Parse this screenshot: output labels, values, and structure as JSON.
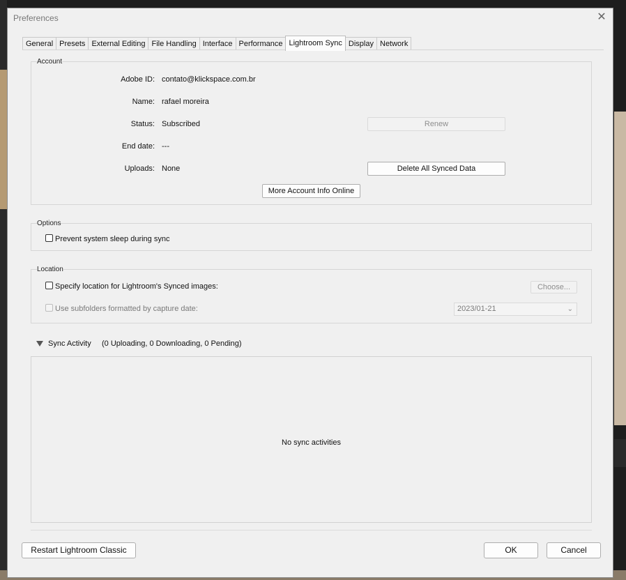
{
  "window": {
    "title": "Preferences"
  },
  "tabs": [
    {
      "label": "General"
    },
    {
      "label": "Presets"
    },
    {
      "label": "External Editing"
    },
    {
      "label": "File Handling"
    },
    {
      "label": "Interface"
    },
    {
      "label": "Performance"
    },
    {
      "label": "Lightroom Sync"
    },
    {
      "label": "Display"
    },
    {
      "label": "Network"
    }
  ],
  "account": {
    "group_title": "Account",
    "adobe_id_label": "Adobe ID:",
    "adobe_id_value": "contato@klickspace.com.br",
    "name_label": "Name:",
    "name_value": "rafael moreira",
    "status_label": "Status:",
    "status_value": "Subscribed",
    "end_date_label": "End date:",
    "end_date_value": "---",
    "uploads_label": "Uploads:",
    "uploads_value": "None",
    "renew_button": "Renew",
    "delete_button": "Delete All Synced Data",
    "more_info_button": "More Account Info Online"
  },
  "options": {
    "group_title": "Options",
    "prevent_sleep_label": "Prevent system sleep during sync"
  },
  "location": {
    "group_title": "Location",
    "specify_label": "Specify location for Lightroom's Synced images:",
    "choose_button": "Choose...",
    "subfolders_label": "Use subfolders formatted by capture date:",
    "date_format_value": "2023/01-21"
  },
  "sync_activity": {
    "title": "Sync Activity",
    "summary": "(0 Uploading, 0 Downloading, 0 Pending)",
    "empty_message": "No sync activities"
  },
  "footer": {
    "restart_button": "Restart Lightroom Classic",
    "ok_button": "OK",
    "cancel_button": "Cancel"
  },
  "colors": {
    "dialog_bg": "#f0f0f0",
    "app_bg": "#1e1e1e"
  }
}
